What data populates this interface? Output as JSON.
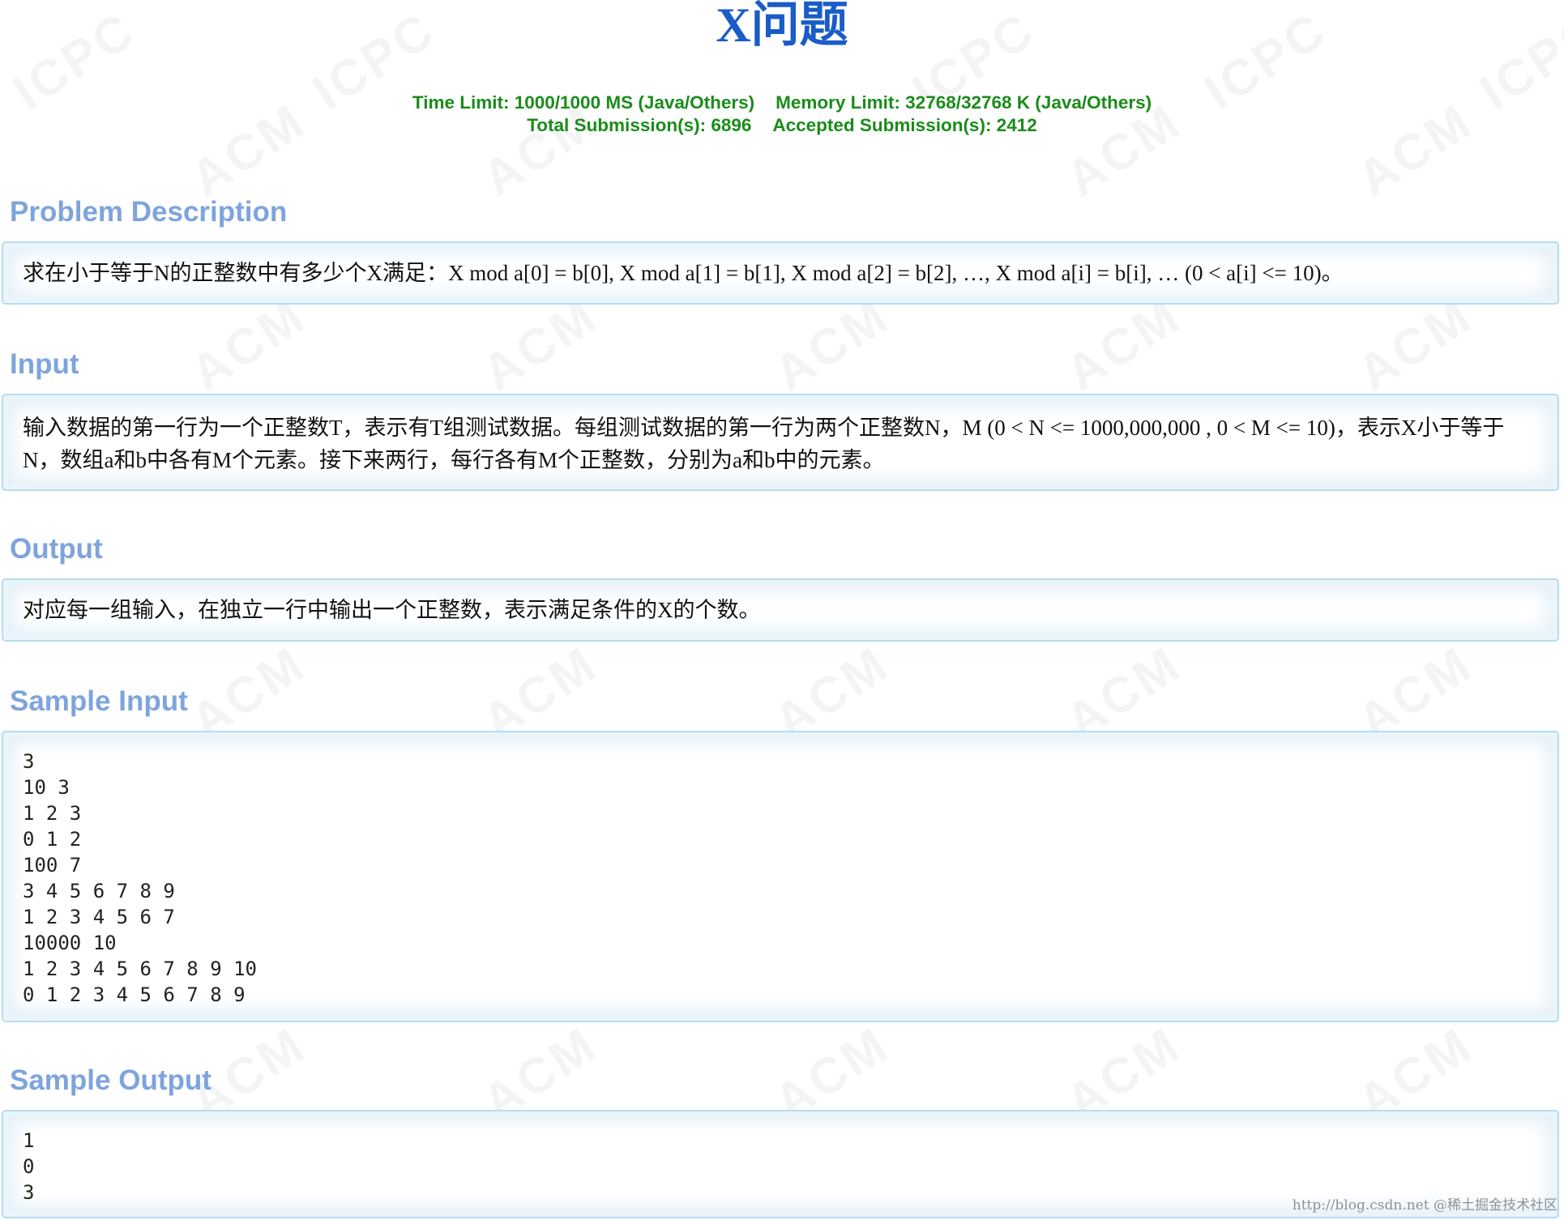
{
  "problem": {
    "title": "X问题",
    "time_limit": "Time Limit: 1000/1000 MS (Java/Others)",
    "memory_limit": "Memory Limit: 32768/32768 K (Java/Others)",
    "total_submissions": "Total Submission(s): 6896",
    "accepted_submissions": "Accepted Submission(s): 2412"
  },
  "sections": {
    "description": {
      "heading": "Problem Description",
      "text": "求在小于等于N的正整数中有多少个X满足：X mod a[0] = b[0], X mod a[1] = b[1], X mod a[2] = b[2], …, X mod a[i] = b[i], … (0 < a[i] <= 10)。"
    },
    "input": {
      "heading": "Input",
      "text": "输入数据的第一行为一个正整数T，表示有T组测试数据。每组测试数据的第一行为两个正整数N，M (0 < N <= 1000,000,000 , 0 < M <= 10)，表示X小于等于N，数组a和b中各有M个元素。接下来两行，每行各有M个正整数，分别为a和b中的元素。"
    },
    "output": {
      "heading": "Output",
      "text": "对应每一组输入，在独立一行中输出一个正整数，表示满足条件的X的个数。"
    },
    "sample_input": {
      "heading": "Sample Input",
      "text": "3\n10 3\n1 2 3\n0 1 2\n100 7\n3 4 5 6 7 8 9\n1 2 3 4 5 6 7\n10000 10\n1 2 3 4 5 6 7 8 9 10\n0 1 2 3 4 5 6 7 8 9"
    },
    "sample_output": {
      "heading": "Sample Output",
      "text": "1\n0\n3"
    }
  },
  "watermark": {
    "text_primary": "ACM",
    "text_secondary": "ICPC",
    "credit": "http://blog.csdn.net @稀土掘金技术社区"
  },
  "colors": {
    "title": "#1a5cc8",
    "meta": "#1a8c1a",
    "heading": "#7ea4dd",
    "panel_border": "#b6dcef",
    "panel_bg": "#eaf3fa"
  }
}
